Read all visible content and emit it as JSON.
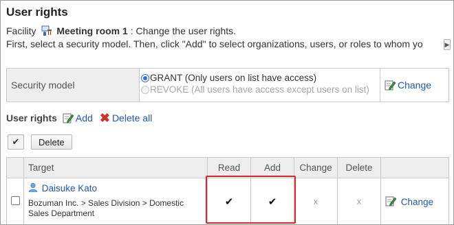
{
  "page": {
    "title": "User rights",
    "facility_prefix": "Facility",
    "facility_name": "Meeting room 1",
    "facility_suffix": ": Change the user rights.",
    "instruction": "First, select a security model. Then, click \"Add\" to select organizations, users, or roles to whom yo"
  },
  "security": {
    "label": "Security model",
    "grant": "GRANT (Only users on list have access)",
    "revoke": "REVOKE (All users have access except users on list)",
    "selected": "GRANT",
    "change": "Change"
  },
  "rights": {
    "label": "User rights",
    "add": "Add",
    "delete_all": "Delete all",
    "check_all_glyph": "✔",
    "delete": "Delete"
  },
  "table": {
    "headers": {
      "target": "Target",
      "read": "Read",
      "add": "Add",
      "change": "Change",
      "delete": "Delete"
    },
    "rows": [
      {
        "user": "Daisuke Kato",
        "department": "Bozuman Inc. > Sales Division > Domestic Sales Department",
        "read": "✔",
        "add": "✔",
        "change": "x",
        "delete": "x",
        "action": "Change"
      }
    ]
  },
  "colors": {
    "link": "#1f57b6",
    "highlight": "#d9262b",
    "header_bg": "#eeeeee"
  }
}
